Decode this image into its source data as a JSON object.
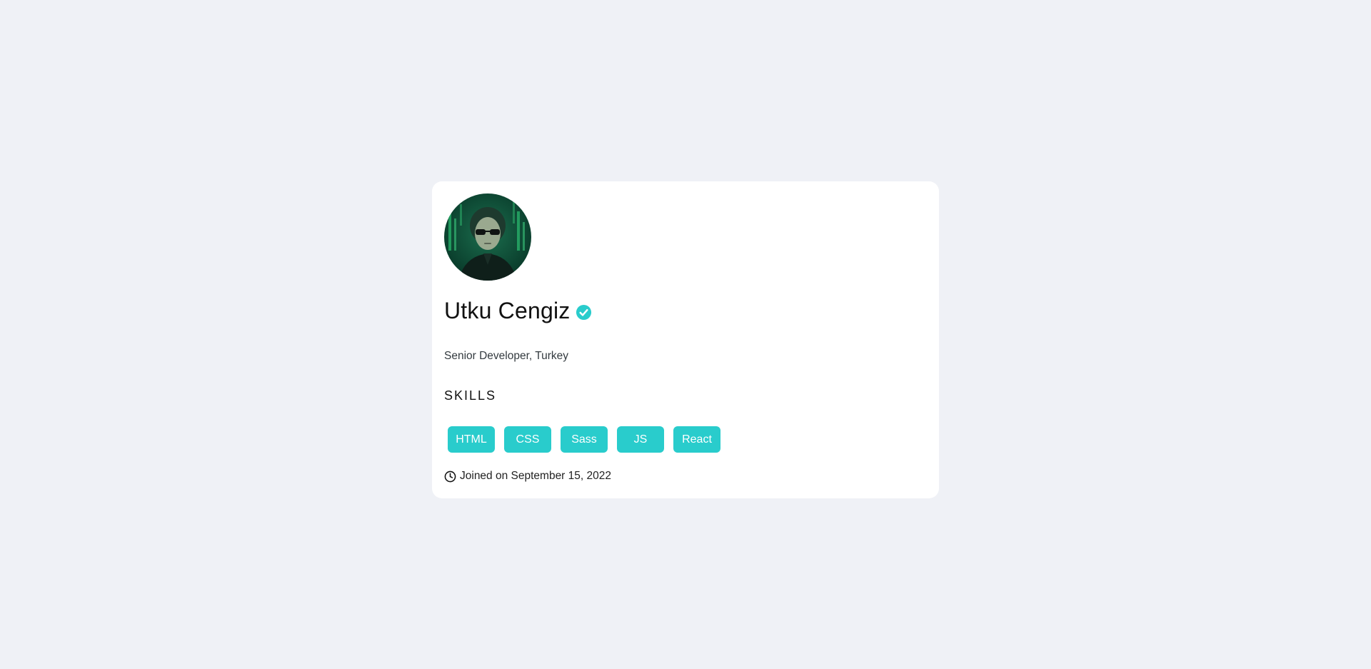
{
  "profile": {
    "name": "Utku Cengiz",
    "title": "Senior Developer, Turkey",
    "skills_heading": "SKILLS",
    "skills": [
      "HTML",
      "CSS",
      "Sass",
      "JS",
      "React"
    ],
    "joined": "Joined on September 15, 2022"
  },
  "icons": {
    "verified": "verified-check-icon",
    "clock": "clock-icon"
  },
  "colors": {
    "accent": "#29cccc",
    "background": "#eff1f6",
    "card": "#ffffff"
  }
}
